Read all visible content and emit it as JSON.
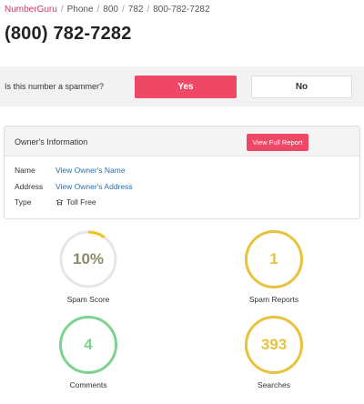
{
  "breadcrumb": {
    "items": [
      "NumberGuru",
      "Phone",
      "800",
      "782",
      "800-782-7282"
    ],
    "separator": "/"
  },
  "page_title": "(800) 782-7282",
  "spam_question": {
    "text": "Is this number a spammer?",
    "yes_label": "Yes",
    "no_label": "No"
  },
  "owner": {
    "title": "Owner's Information",
    "report_button": "View Full Report",
    "rows": [
      {
        "label": "Name",
        "value": "View Owner's Name"
      },
      {
        "label": "Address",
        "value": "View Owner's Address"
      },
      {
        "label": "Type",
        "value": "Toll Free",
        "icon": "phone-icon"
      }
    ]
  },
  "stats": {
    "spam_score": {
      "value": "10%",
      "label": "Spam Score",
      "fraction": 0.1
    },
    "spam_reports": {
      "value": "1",
      "label": "Spam Reports"
    },
    "comments": {
      "value": "4",
      "label": "Comments"
    },
    "searches": {
      "value": "393",
      "label": "Searches"
    }
  },
  "colors": {
    "accent": "#ef4766",
    "link": "#2d6fb0",
    "spam_score_ring": "#e6e6e6",
    "spam_score_arc": "#f0c419",
    "spam_score_text": "#8a8a6a",
    "reports_ring": "#e8c23d",
    "comments_ring": "#7ed28f",
    "searches_ring": "#e8c23d"
  }
}
